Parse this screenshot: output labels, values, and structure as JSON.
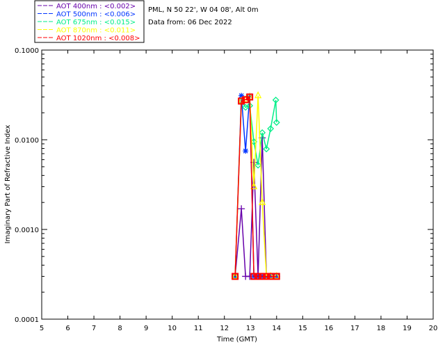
{
  "chart_data": {
    "type": "line",
    "header": {
      "site": "PML, N 50 22', W 04 08', Alt 0m",
      "date": "Data from: 06 Dec 2022"
    },
    "xlabel": "Time (GMT)",
    "ylabel": "Imaginary Part of Refractive Index",
    "xlim": [
      5,
      20
    ],
    "ylim": [
      0.0001,
      0.1
    ],
    "yscale": "log",
    "xticks": [
      "5",
      "6",
      "7",
      "8",
      "9",
      "10",
      "11",
      "12",
      "13",
      "14",
      "15",
      "16",
      "17",
      "18",
      "19",
      "20"
    ],
    "yticks": [
      "0.0001",
      "0.0010",
      "0.0100",
      "0.1000"
    ],
    "legend_placement": "top-left, outside",
    "series": [
      {
        "name": "AOT  400nm : <0.002>",
        "color": "#6600aa",
        "marker": "plus",
        "x": [
          12.41,
          12.65,
          12.81,
          12.97,
          13.13,
          13.29,
          13.45,
          13.61,
          13.77,
          14.0
        ],
        "y": [
          0.0003,
          0.0017,
          0.0003,
          0.0003,
          0.0056,
          0.0003,
          0.0105,
          0.0003,
          0.0003,
          0.0003
        ]
      },
      {
        "name": "AOT  500nm : <0.006>",
        "color": "#0033ff",
        "marker": "asterisk",
        "x": [
          12.41,
          12.65,
          12.81,
          12.97,
          13.13,
          13.29,
          13.45,
          13.61,
          13.77,
          14.0
        ],
        "y": [
          0.0003,
          0.031,
          0.0075,
          0.031,
          0.0003,
          0.0003,
          0.0003,
          0.0003,
          0.0003,
          0.0003
        ]
      },
      {
        "name": "AOT  675nm : <0.015>",
        "color": "#00ee88",
        "marker": "diamond",
        "x": [
          12.41,
          12.65,
          12.81,
          12.97,
          13.13,
          13.29,
          13.45,
          13.61,
          13.77,
          13.97,
          14.0
        ],
        "y": [
          0.0003,
          0.027,
          0.023,
          0.024,
          0.0095,
          0.0052,
          0.012,
          0.0079,
          0.0133,
          0.0277,
          0.0156
        ]
      },
      {
        "name": "AOT  870nm : <0.011>",
        "color": "#ffff00",
        "marker": "triangle",
        "x": [
          12.41,
          12.65,
          12.81,
          12.97,
          13.13,
          13.29,
          13.45,
          13.61,
          13.77,
          14.0
        ],
        "y": [
          0.0003,
          0.027,
          0.028,
          0.03,
          0.003,
          0.031,
          0.002,
          0.0003,
          0.0003,
          0.0003
        ]
      },
      {
        "name": "AOT 1020nm : <0.008>",
        "color": "#ff0000",
        "marker": "square",
        "x": [
          12.41,
          12.65,
          12.81,
          12.97,
          13.13,
          13.29,
          13.45,
          13.61,
          13.77,
          14.0
        ],
        "y": [
          0.0003,
          0.027,
          0.028,
          0.03,
          0.0003,
          0.0003,
          0.0003,
          0.0003,
          0.0003,
          0.0003
        ]
      }
    ]
  }
}
